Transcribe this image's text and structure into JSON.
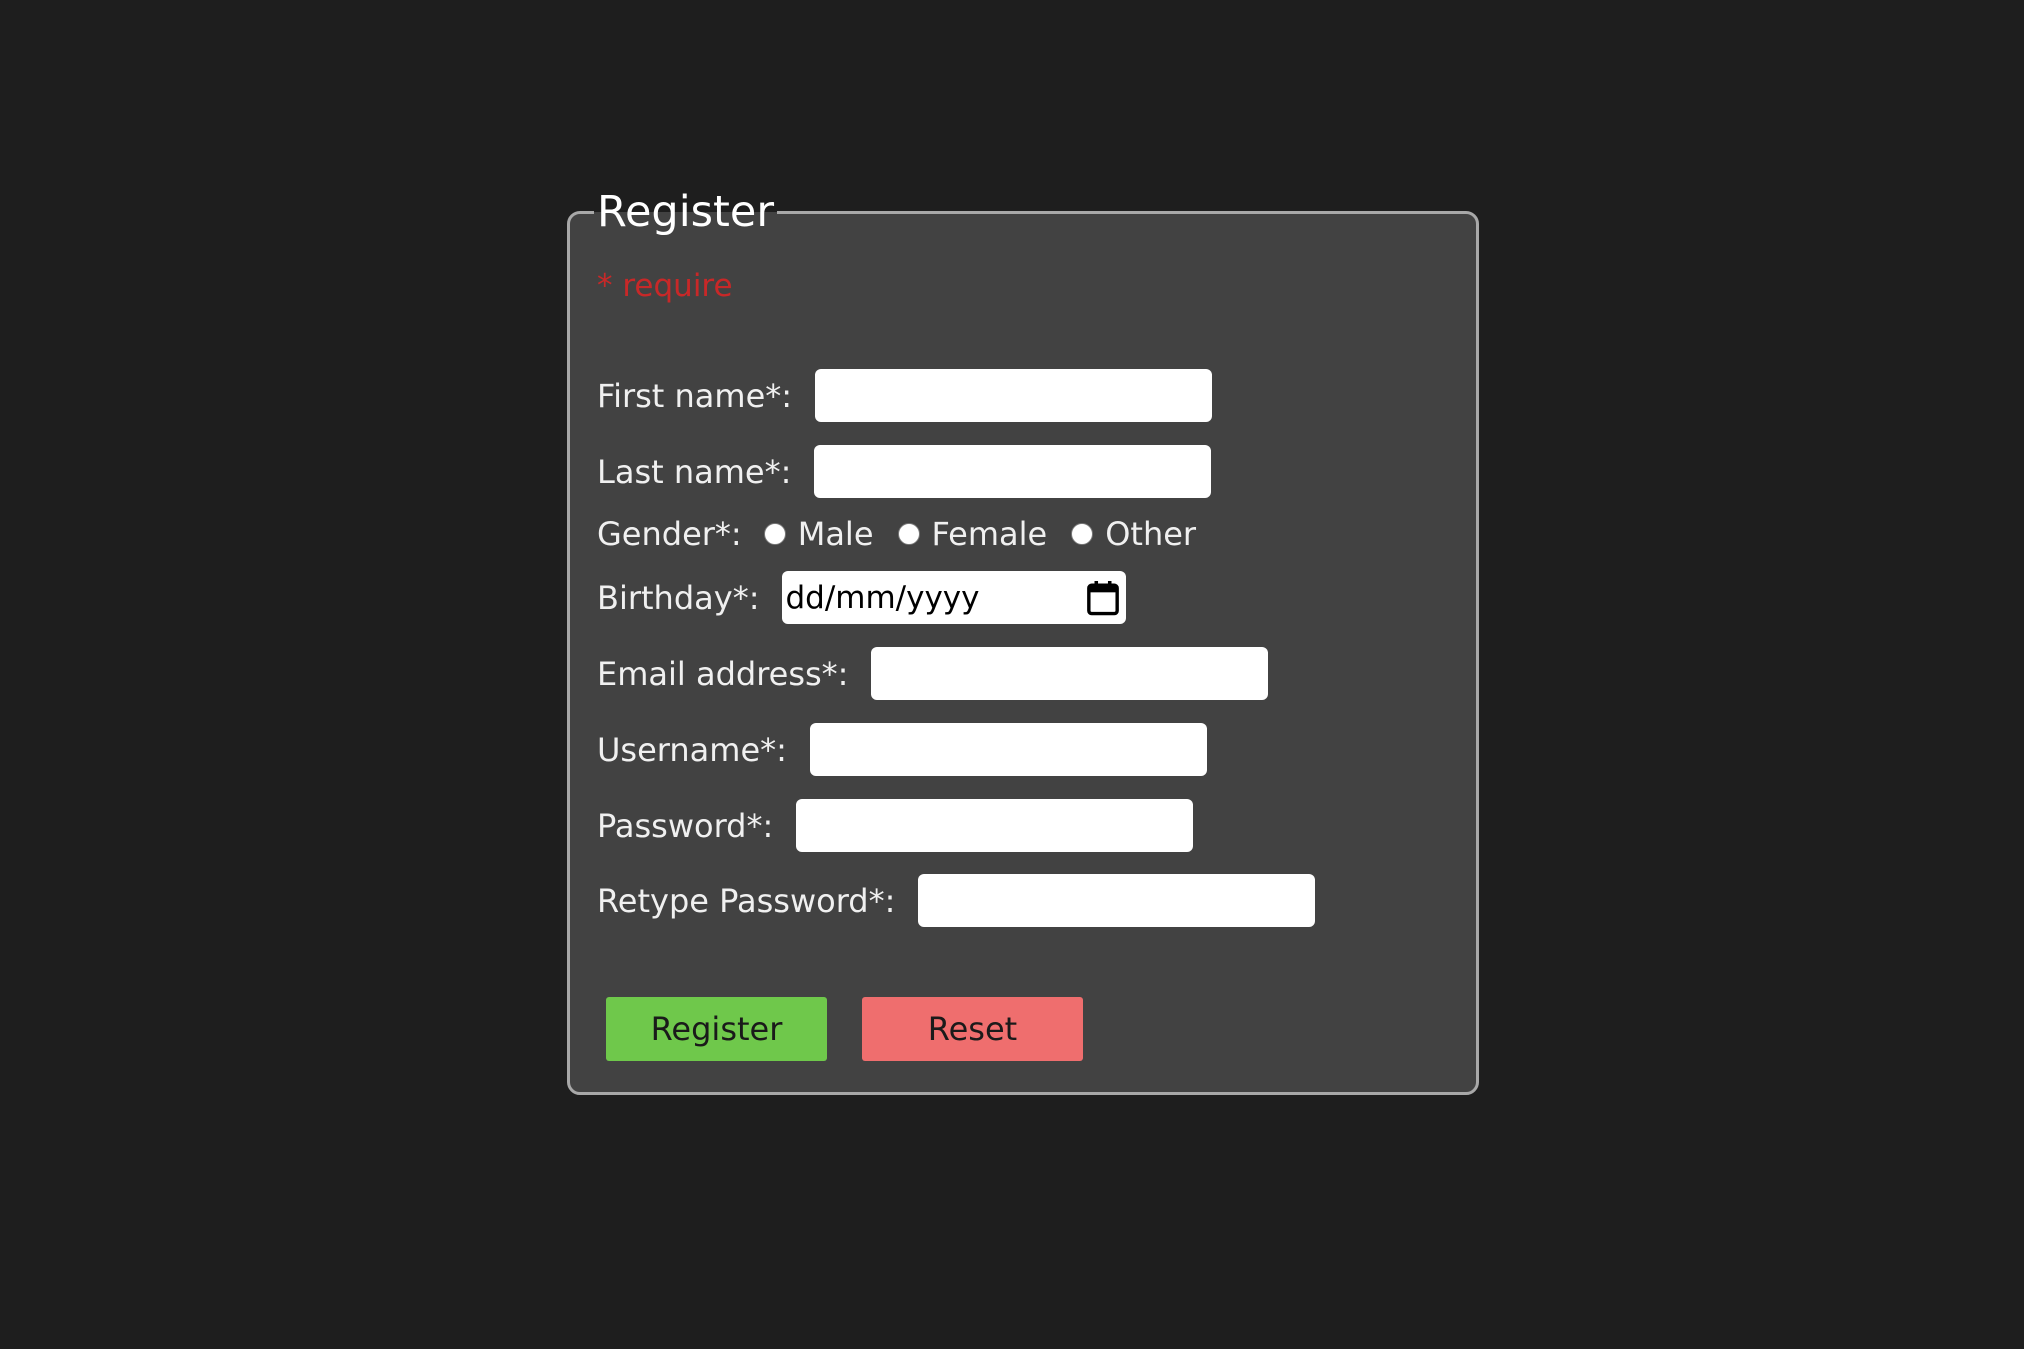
{
  "form": {
    "legend": "Register",
    "require_note": "* require",
    "fields": {
      "first_name": {
        "label": "First name*:",
        "value": ""
      },
      "last_name": {
        "label": "Last name*:",
        "value": ""
      },
      "gender": {
        "label": "Gender*:",
        "options": [
          "Male",
          "Female",
          "Other"
        ],
        "selected": null
      },
      "birthday": {
        "label": "Birthday*:",
        "placeholder": "dd/mm/yyyy",
        "icon": "calendar-icon"
      },
      "email": {
        "label": "Email address*:",
        "value": ""
      },
      "username": {
        "label": "Username*:",
        "value": ""
      },
      "password": {
        "label": "Password*:",
        "value": ""
      },
      "retype_password": {
        "label": "Retype Password*:",
        "value": ""
      }
    },
    "buttons": {
      "register": "Register",
      "reset": "Reset"
    }
  },
  "colors": {
    "page_background": "#1e1e1e",
    "panel_background": "#424242",
    "panel_border": "#a8a8a8",
    "require_text": "#c82828",
    "register_button": "#6fc84b",
    "reset_button": "#ef6e6e"
  }
}
